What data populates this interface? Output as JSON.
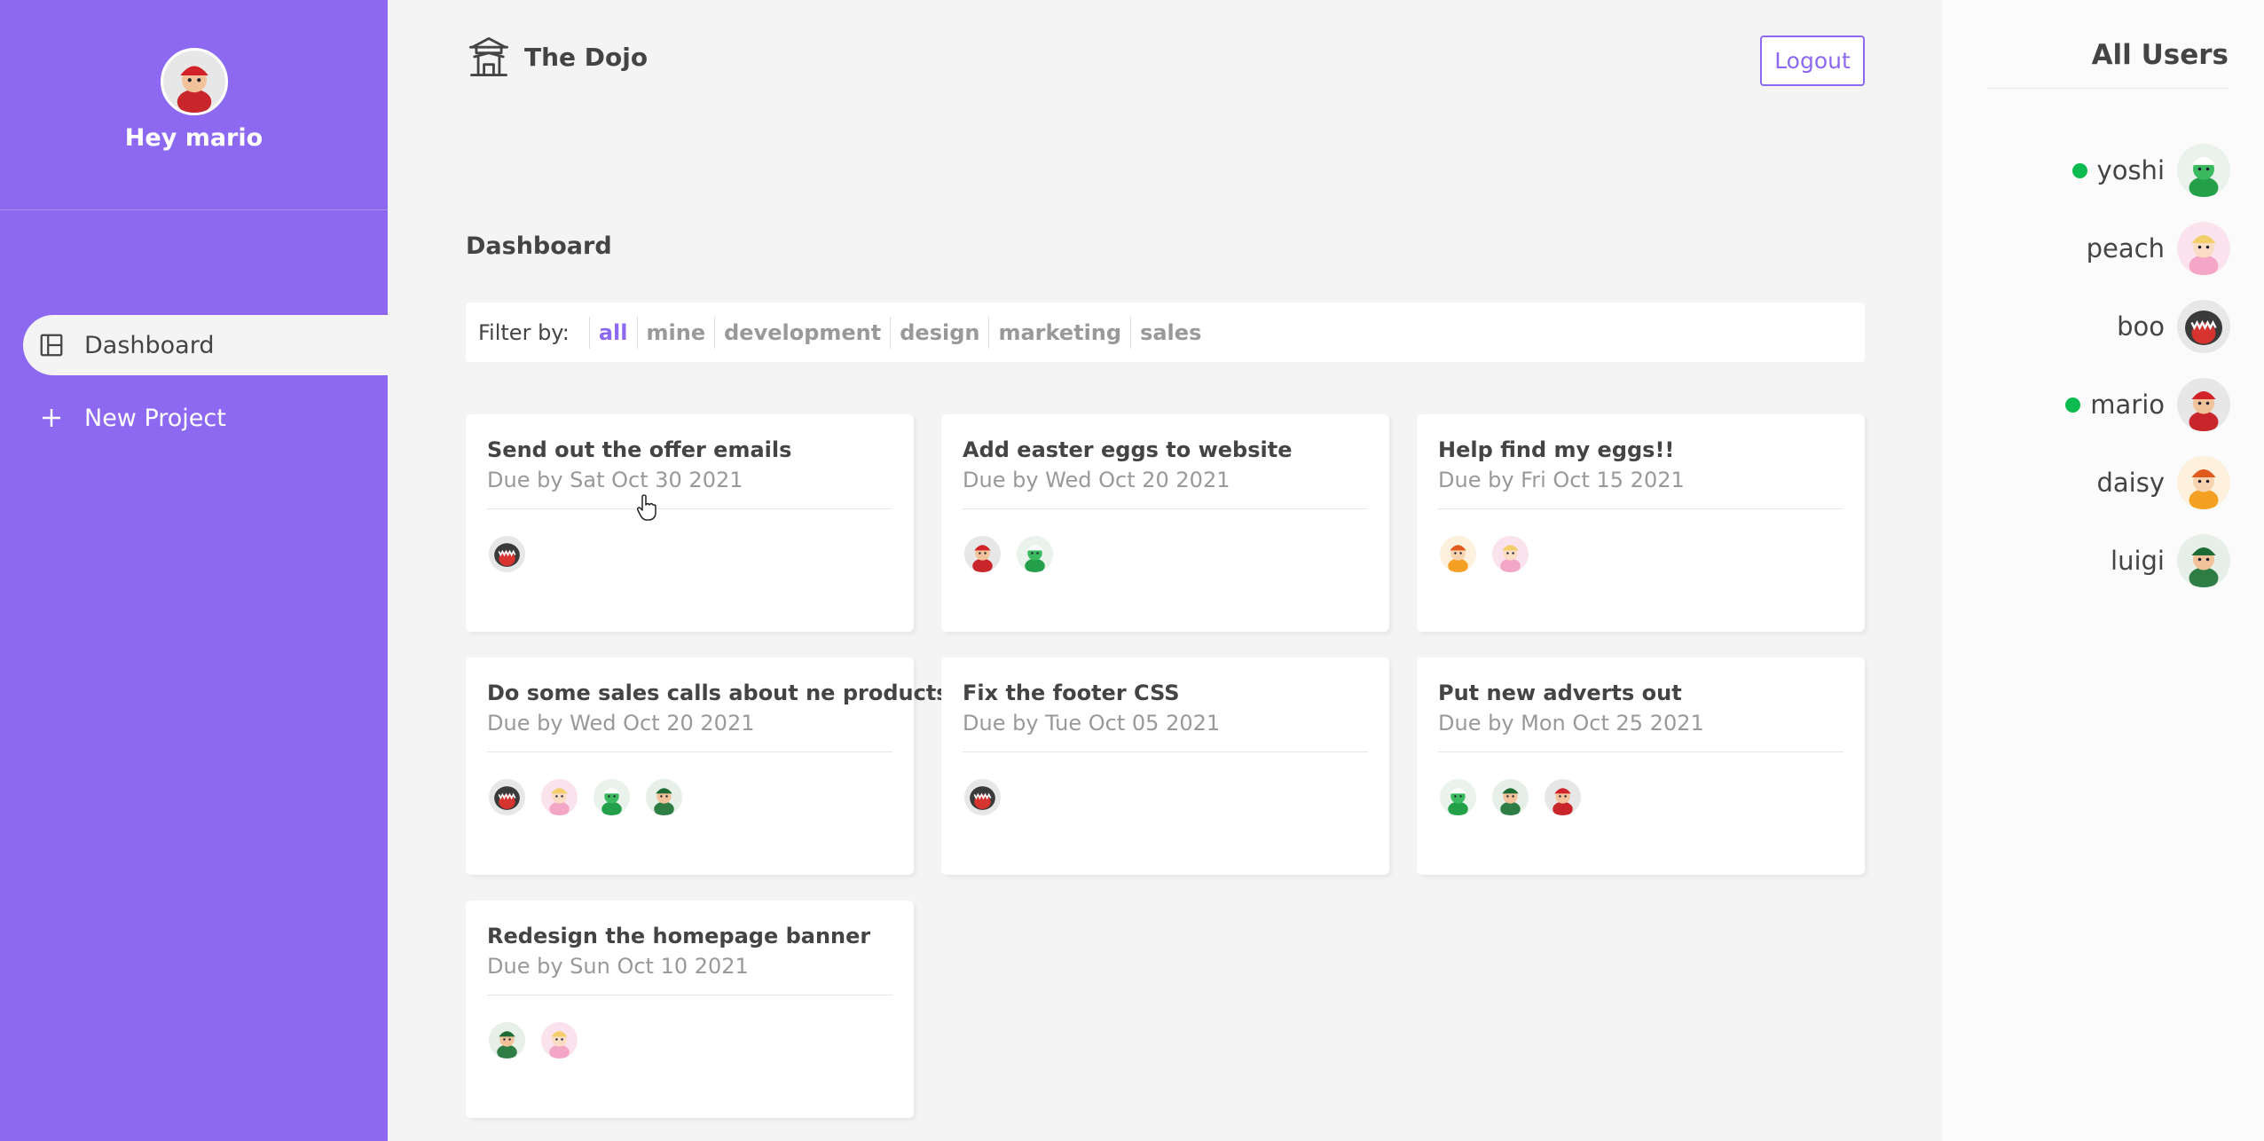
{
  "sidebar": {
    "greeting": "Hey mario",
    "avatar": "mario",
    "nav": [
      {
        "label": "Dashboard",
        "icon": "dashboard-icon",
        "active": true
      },
      {
        "label": "New Project",
        "icon": "add-icon",
        "active": false
      }
    ]
  },
  "header": {
    "brand": "The Dojo",
    "brand_icon": "temple-icon",
    "logout_label": "Logout"
  },
  "main": {
    "title": "Dashboard",
    "filter": {
      "label": "Filter by:",
      "options": [
        "all",
        "mine",
        "development",
        "design",
        "marketing",
        "sales"
      ],
      "selected": "all"
    }
  },
  "projects": [
    {
      "title": "Send out the offer emails",
      "due": "Due by Sat Oct 30 2021",
      "assigned": [
        "boo"
      ]
    },
    {
      "title": "Add easter eggs to website",
      "due": "Due by Wed Oct 20 2021",
      "assigned": [
        "mario",
        "yoshi"
      ]
    },
    {
      "title": "Help find my eggs!!",
      "due": "Due by Fri Oct 15 2021",
      "assigned": [
        "daisy",
        "peach"
      ]
    },
    {
      "title": "Do some sales calls about ne products",
      "due": "Due by Wed Oct 20 2021",
      "assigned": [
        "boo",
        "peach",
        "yoshi",
        "luigi"
      ]
    },
    {
      "title": "Fix the footer CSS",
      "due": "Due by Tue Oct 05 2021",
      "assigned": [
        "boo"
      ]
    },
    {
      "title": "Put new adverts out",
      "due": "Due by Mon Oct 25 2021",
      "assigned": [
        "yoshi",
        "luigi",
        "mario"
      ]
    },
    {
      "title": "Redesign the homepage banner",
      "due": "Due by Sun Oct 10 2021",
      "assigned": [
        "luigi",
        "peach"
      ]
    }
  ],
  "users_panel": {
    "title": "All Users",
    "users": [
      {
        "name": "yoshi",
        "online": true
      },
      {
        "name": "peach",
        "online": false
      },
      {
        "name": "boo",
        "online": false
      },
      {
        "name": "mario",
        "online": true
      },
      {
        "name": "daisy",
        "online": false
      },
      {
        "name": "luigi",
        "online": false
      }
    ]
  },
  "colors": {
    "primary": "#8d69f1",
    "background": "#f4f4f4",
    "online": "#0ebb50",
    "heading": "#444444",
    "muted": "#999999"
  }
}
